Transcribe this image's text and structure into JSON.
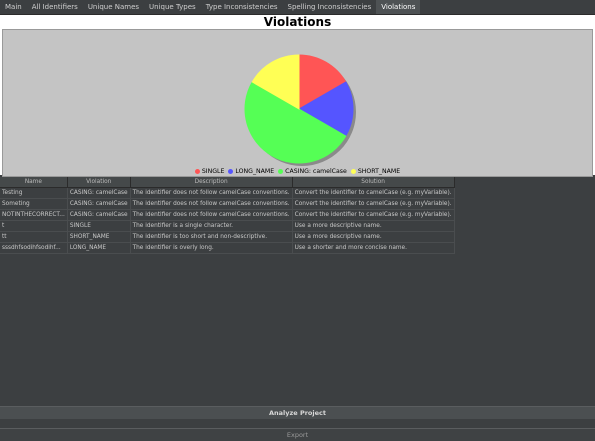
{
  "tabs": [
    {
      "label": "Main",
      "active": false
    },
    {
      "label": "All Identifiers",
      "active": false
    },
    {
      "label": "Unique Names",
      "active": false
    },
    {
      "label": "Unique Types",
      "active": false
    },
    {
      "label": "Type Inconsistencies",
      "active": false
    },
    {
      "label": "Spelling Inconsistencies",
      "active": false
    },
    {
      "label": "Violations",
      "active": true
    }
  ],
  "chart_title": "Violations",
  "chart_data": {
    "type": "pie",
    "title": "Violations",
    "slices": [
      {
        "name": "SINGLE",
        "value": 1,
        "color": "#ff5555"
      },
      {
        "name": "LONG_NAME",
        "value": 1,
        "color": "#5555ff"
      },
      {
        "name": "CASING: camelCase",
        "value": 3,
        "color": "#55ff55"
      },
      {
        "name": "SHORT_NAME",
        "value": 1,
        "color": "#ffff55"
      }
    ],
    "legend_position": "bottom"
  },
  "table": {
    "headers": [
      "Name",
      "Violation",
      "Description",
      "Solution"
    ],
    "rows": [
      [
        "Testing",
        "CASING: camelCase",
        "The identifier does not follow camelCase conventions.",
        "Convert the identifier to camelCase (e.g. myVariable)."
      ],
      [
        "Someting",
        "CASING: camelCase",
        "The identifier does not follow camelCase conventions.",
        "Convert the identifier to camelCase (e.g. myVariable)."
      ],
      [
        "NOTINTHECORRECT...",
        "CASING: camelCase",
        "The identifier does not follow camelCase conventions.",
        "Convert the identifier to camelCase (e.g. myVariable)."
      ],
      [
        "t",
        "SINGLE",
        "The identifier is a single character.",
        "Use a more descriptive name."
      ],
      [
        "tt",
        "SHORT_NAME",
        "The identifier is too short and non-descriptive.",
        "Use a more descriptive name."
      ],
      [
        "sssdhfsodihfsodihf...",
        "LONG_NAME",
        "The identifier is overly long.",
        "Use a shorter and more concise name."
      ]
    ]
  },
  "buttons": {
    "analyze": "Analyze Project",
    "export": "Export"
  }
}
